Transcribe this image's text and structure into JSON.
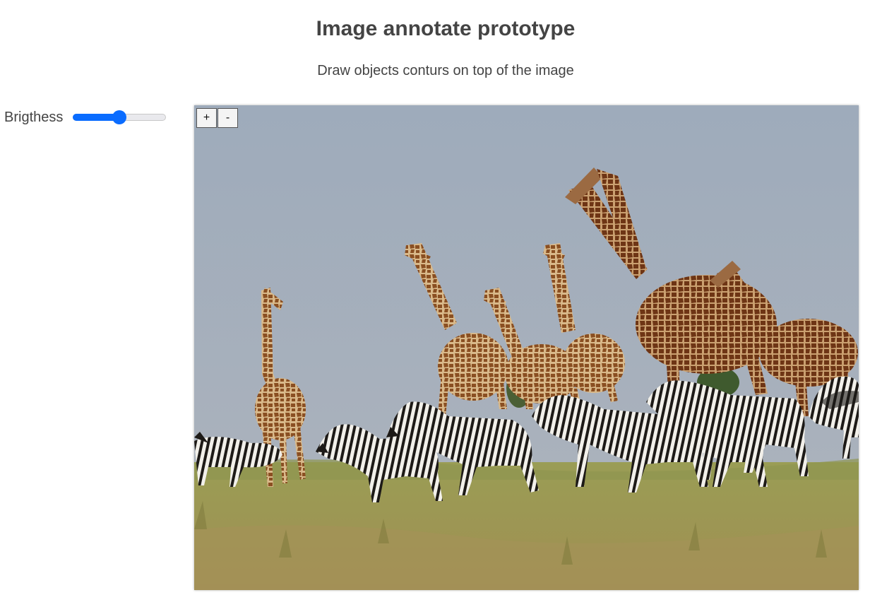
{
  "header": {
    "title": "Image annotate prototype",
    "subtitle": "Draw objects conturs on top of the image"
  },
  "sidebar": {
    "brightness": {
      "label": "Brigthess",
      "value": 0.5
    }
  },
  "viewer": {
    "zoom_in_label": "+",
    "zoom_out_label": "-"
  },
  "colors": {
    "accent": "#0a6cff",
    "sky": "#a3adb8",
    "grass": "#9a9a4e"
  }
}
